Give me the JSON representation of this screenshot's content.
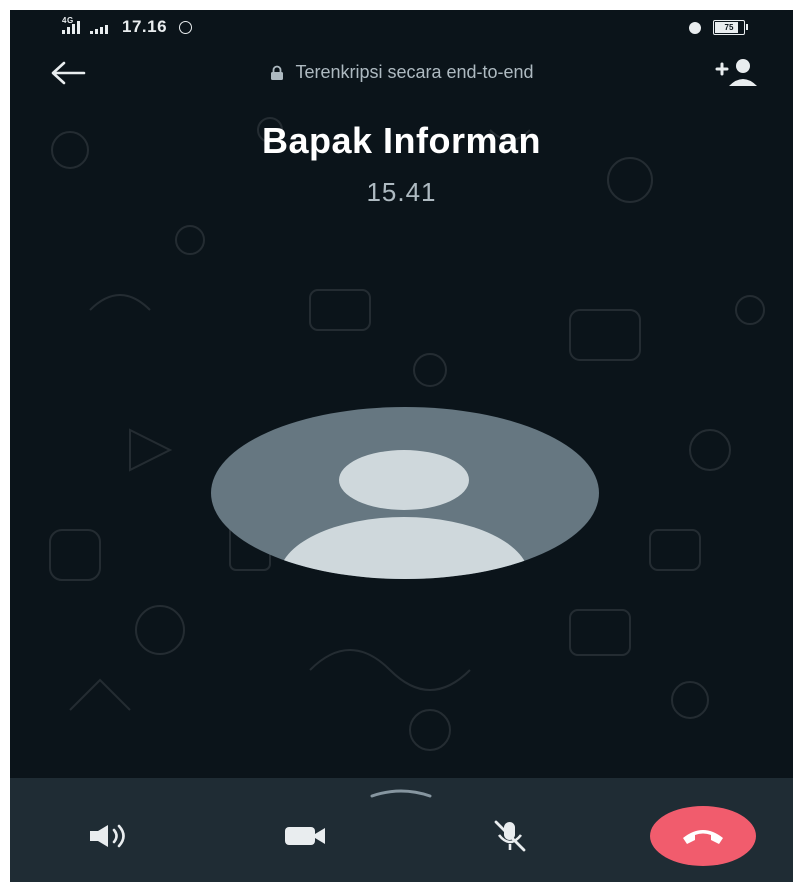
{
  "status_bar": {
    "network": "4G",
    "time": "17.16",
    "battery": "75"
  },
  "header": {
    "encryption_text": "Terenkripsi secara end-to-end"
  },
  "call": {
    "caller_name": "Bapak Informan",
    "duration": "15.41"
  },
  "controls": {
    "speaker": "speaker-icon",
    "video": "video-camera-icon",
    "mute": "microphone-muted-icon",
    "end_call": "end-call-icon"
  },
  "colors": {
    "background": "#0b141a",
    "panel": "#1f2c34",
    "end_call": "#f15c6d",
    "avatar": "#667781"
  }
}
